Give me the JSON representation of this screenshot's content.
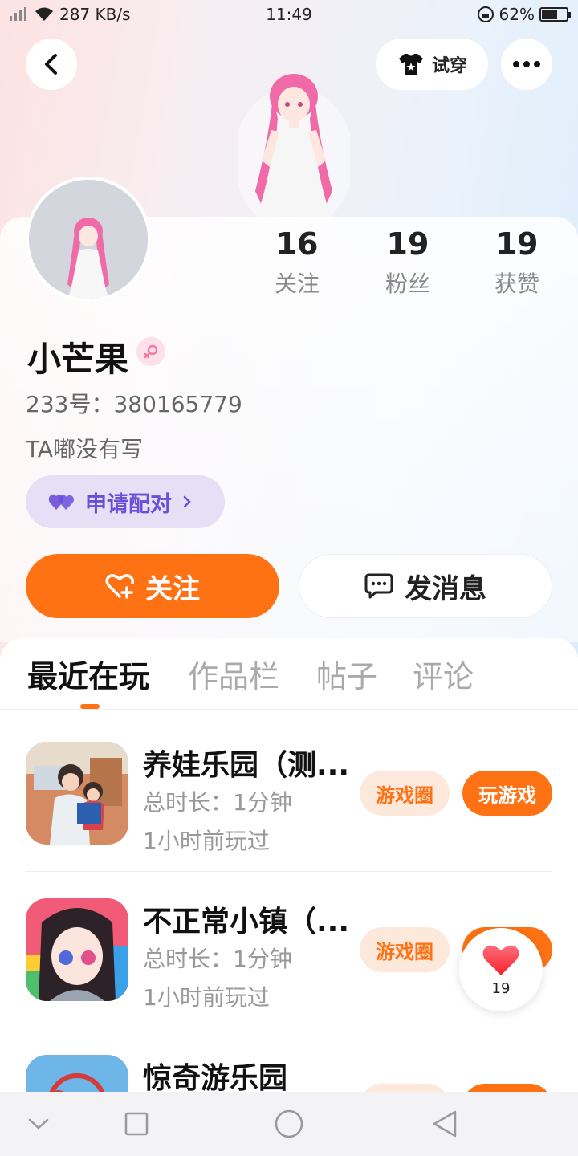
{
  "status_bar": {
    "network_speed": "287 KB/s",
    "time": "11:49",
    "battery": "62%",
    "battery_level": 0.62
  },
  "header": {
    "try_on_label": "试穿"
  },
  "profile": {
    "following_count": "16",
    "following_label": "关注",
    "fans_count": "19",
    "fans_label": "粉丝",
    "likes_count": "19",
    "likes_label": "获赞",
    "name": "小芒果",
    "uid": "233号：380165779",
    "bio": "TA嘟没有写",
    "pair_label": "申请配对"
  },
  "actions": {
    "follow_label": "关注",
    "message_label": "发消息"
  },
  "tabs": [
    {
      "label": "最近在玩",
      "active": true
    },
    {
      "label": "作品栏",
      "active": false
    },
    {
      "label": "帖子",
      "active": false
    },
    {
      "label": "评论",
      "active": false
    }
  ],
  "games": [
    {
      "title": "养娃乐园（测...",
      "duration": "总时长：1分钟",
      "last_played": "1小时前玩过",
      "circle_label": "游戏圈",
      "play_label": "玩游戏"
    },
    {
      "title": "不正常小镇（...",
      "duration": "总时长：1分钟",
      "last_played": "1小时前玩过",
      "circle_label": "游戏圈",
      "play_label": "玩游戏"
    },
    {
      "title": "惊奇游乐园",
      "duration": "",
      "last_played": "",
      "circle_label": "",
      "play_label": ""
    }
  ],
  "floating_like": {
    "count": "19"
  },
  "colors": {
    "accent": "#ff7214",
    "pair": "#6a4fd8"
  }
}
